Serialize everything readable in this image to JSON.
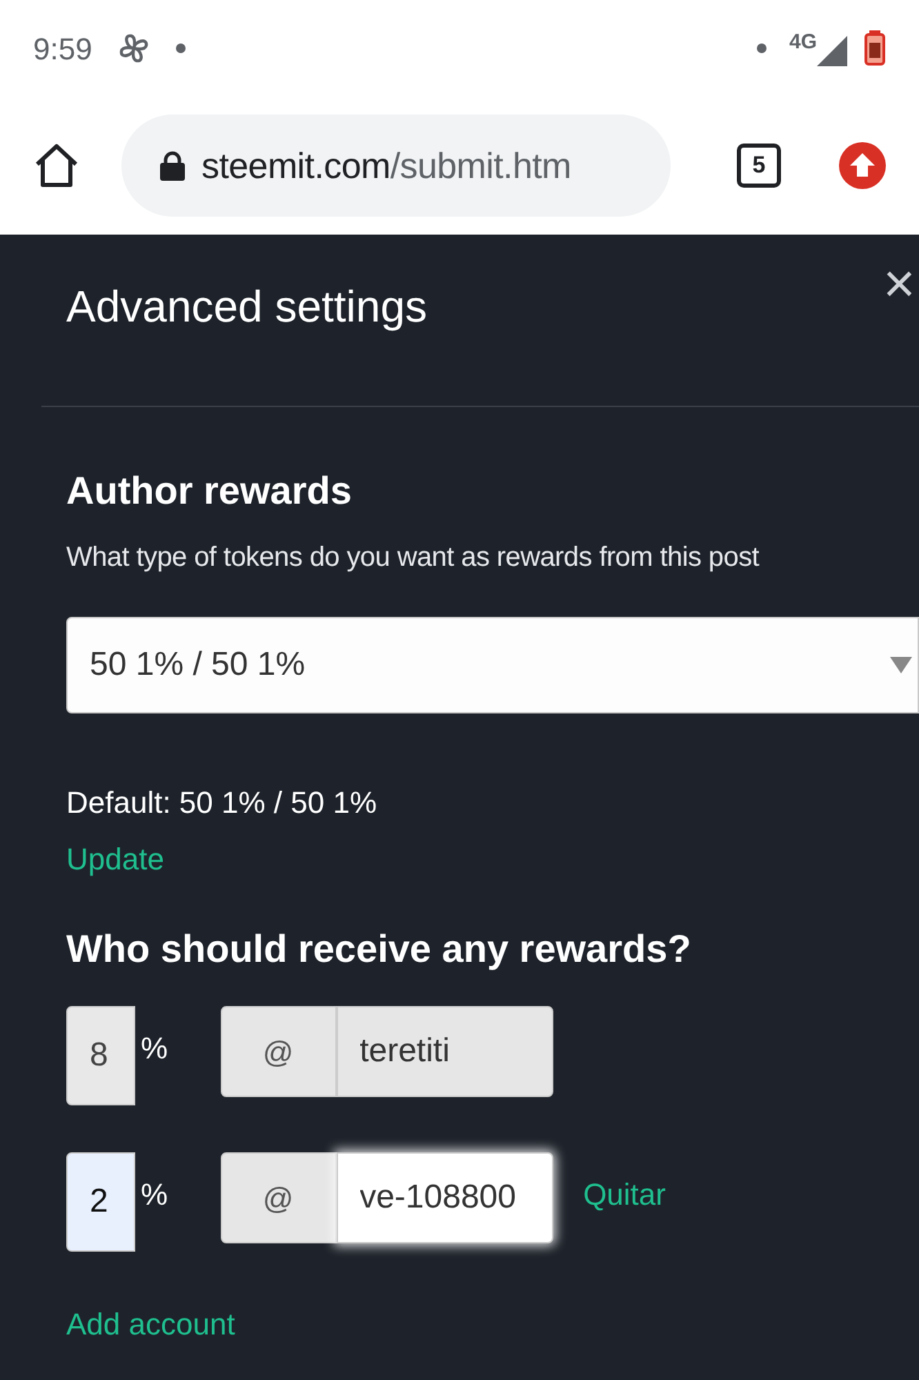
{
  "status_bar": {
    "time": "9:59",
    "network": "4G"
  },
  "browser": {
    "url_host": "steemit.com",
    "url_path": "/submit.htm",
    "tab_count": "5"
  },
  "dialog": {
    "title": "Advanced settings",
    "close": "×"
  },
  "author_rewards": {
    "heading": "Author rewards",
    "description": "What type of tokens do you want as rewards from this post",
    "select_value": "50 1% / 50 1%",
    "default_text": "Default: 50 1% / 50 1%",
    "update_link": "Update"
  },
  "beneficiaries": {
    "heading": "Who should receive any rewards?",
    "rows": [
      {
        "percent": "8",
        "percent_sign": "%",
        "at": "@",
        "account": "teretiti",
        "disabled": true,
        "focused": false
      },
      {
        "percent": "2",
        "percent_sign": "%",
        "at": "@",
        "account": "ve-108800",
        "disabled": false,
        "focused": true,
        "remove_label": "Quitar"
      }
    ],
    "add_link": "Add account"
  }
}
